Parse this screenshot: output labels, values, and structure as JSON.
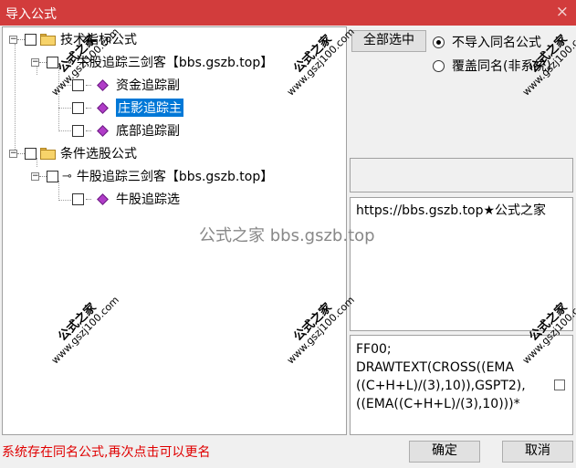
{
  "window": {
    "title": "导入公式",
    "close_icon": "×"
  },
  "tree": {
    "groups": [
      {
        "label": "技术指标公式",
        "expander": "−",
        "children": [
          {
            "label": "牛股追踪三剑客【bbs.gszb.top】",
            "expander": "−",
            "items": [
              {
                "label": "资金追踪副",
                "selected": false
              },
              {
                "label": "庄影追踪主",
                "selected": true
              },
              {
                "label": "底部追踪副",
                "selected": false
              }
            ]
          }
        ]
      },
      {
        "label": "条件选股公式",
        "expander": "−",
        "children": [
          {
            "label": "牛股追踪三剑客【bbs.gszb.top】",
            "expander": "−",
            "items": [
              {
                "label": "牛股追踪选",
                "selected": false
              }
            ]
          }
        ]
      }
    ]
  },
  "buttons": {
    "select_all": "全部选中",
    "ok": "确定",
    "cancel": "取消"
  },
  "radios": [
    {
      "label": "不导入同名公式",
      "checked": true
    },
    {
      "label": "覆盖同名(非系统)",
      "checked": false
    }
  ],
  "description_text": "https://bbs.gszb.top★公式之家",
  "code_text": "FF00;\nDRAWTEXT(CROSS((EMA((C+H+L)/(3),10)),GSPT2),((EMA((C+H+L)/(3),10)))*",
  "code_lines": [
    "FF00;",
    "DRAWTEXT(CROSS((EMA",
    "((C+H+L)/(3),10)),GSPT2),",
    "((EMA((C+H+L)/(3),10)))*"
  ],
  "status_text": "系统存在同名公式,再次点击可以更名",
  "watermark": {
    "brand": "公式之家",
    "url": "www.gszj100.com",
    "center": "公式之家 bbs.gszb.top"
  },
  "colors": {
    "titlebar": "#d23c3c",
    "selected": "#0078d7",
    "status": "#e00000"
  }
}
